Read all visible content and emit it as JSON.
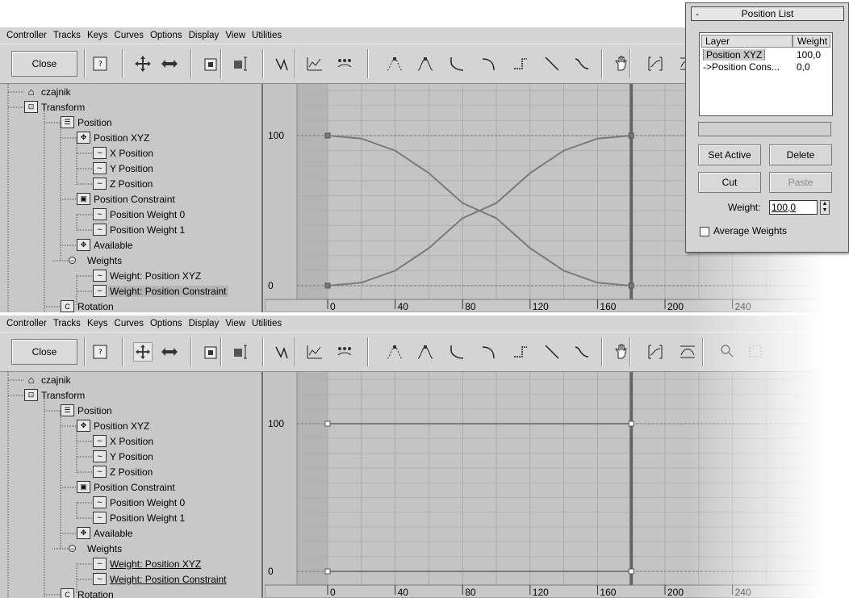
{
  "menu": [
    "Controller",
    "Tracks",
    "Keys",
    "Curves",
    "Options",
    "Display",
    "View",
    "Utilities"
  ],
  "toolbar": {
    "close_label": "Close",
    "icons": [
      "filter-icon",
      "move-keys-icon",
      "slide-keys-icon",
      "scale-keys-icon",
      "scale-values-icon",
      "add-key-icon",
      "draw-curves-icon",
      "reduce-keys-icon",
      "tangent-auto-icon",
      "tangent-custom-icon",
      "tangent-fast-icon",
      "tangent-slow-icon",
      "tangent-step-icon",
      "tangent-linear-icon",
      "tangent-smooth-icon",
      "pan-icon",
      "zoom-horizontal-extents-icon",
      "zoom-value-extents-icon",
      "zoom-icon",
      "zoom-region-icon"
    ]
  },
  "tree": [
    {
      "label": "czajnik",
      "icon": "teapot-icon"
    },
    {
      "label": "Transform",
      "icon": "transform-icon"
    },
    {
      "label": "Position",
      "icon": "position-list-icon"
    },
    {
      "label": "Position XYZ",
      "icon": "position-xyz-icon"
    },
    {
      "label": "X Position",
      "icon": "curve-icon"
    },
    {
      "label": "Y Position",
      "icon": "curve-icon"
    },
    {
      "label": "Z Position",
      "icon": "curve-icon"
    },
    {
      "label": "Position Constraint",
      "icon": "constraint-lock-icon"
    },
    {
      "label": "Position Weight 0",
      "icon": "curve-icon"
    },
    {
      "label": "Position Weight 1",
      "icon": "curve-icon"
    },
    {
      "label": "Available",
      "icon": "position-xyz-icon"
    },
    {
      "label": "Weights",
      "icon": "expand-icon"
    },
    {
      "label": "Weight: Position XYZ",
      "icon": "curve-icon"
    },
    {
      "label": "Weight: Position Constraint",
      "icon": "curve-icon"
    },
    {
      "label": "Rotation",
      "icon": "rotation-icon"
    }
  ],
  "graph": {
    "y_labels": [
      "100",
      "0"
    ],
    "x_labels": [
      "0",
      "40",
      "80",
      "120",
      "160",
      "200",
      "240"
    ]
  },
  "chart_data": [
    {
      "type": "line",
      "name_hint": "top graph",
      "x": [
        0,
        20,
        40,
        60,
        80,
        100,
        120,
        140,
        160,
        180
      ],
      "series": [
        {
          "values": [
            100,
            98,
            90,
            75,
            55,
            45,
            25,
            10,
            2,
            0
          ]
        },
        {
          "values": [
            0,
            2,
            10,
            25,
            45,
            55,
            75,
            90,
            98,
            100
          ]
        }
      ],
      "xlim": [
        0,
        180
      ],
      "ylim": [
        0,
        100
      ]
    },
    {
      "type": "line",
      "name_hint": "bottom graph",
      "x": [
        0,
        180
      ],
      "series": [
        {
          "values": [
            100,
            100
          ]
        },
        {
          "values": [
            0,
            0
          ]
        }
      ],
      "xlim": [
        0,
        180
      ],
      "ylim": [
        0,
        100
      ]
    }
  ],
  "panel": {
    "title": "Position List",
    "minus": "-",
    "col_layer": "Layer",
    "col_weight": "Weight",
    "rows": [
      {
        "layer": "Position XYZ",
        "weight": "100,0"
      },
      {
        "layer": "->Position Cons...",
        "weight": "0,0"
      }
    ],
    "set_active": "Set Active",
    "delete": "Delete",
    "cut": "Cut",
    "paste": "Paste",
    "weight_label": "Weight:",
    "weight_value": "100,0",
    "average_weights": "Average Weights"
  }
}
